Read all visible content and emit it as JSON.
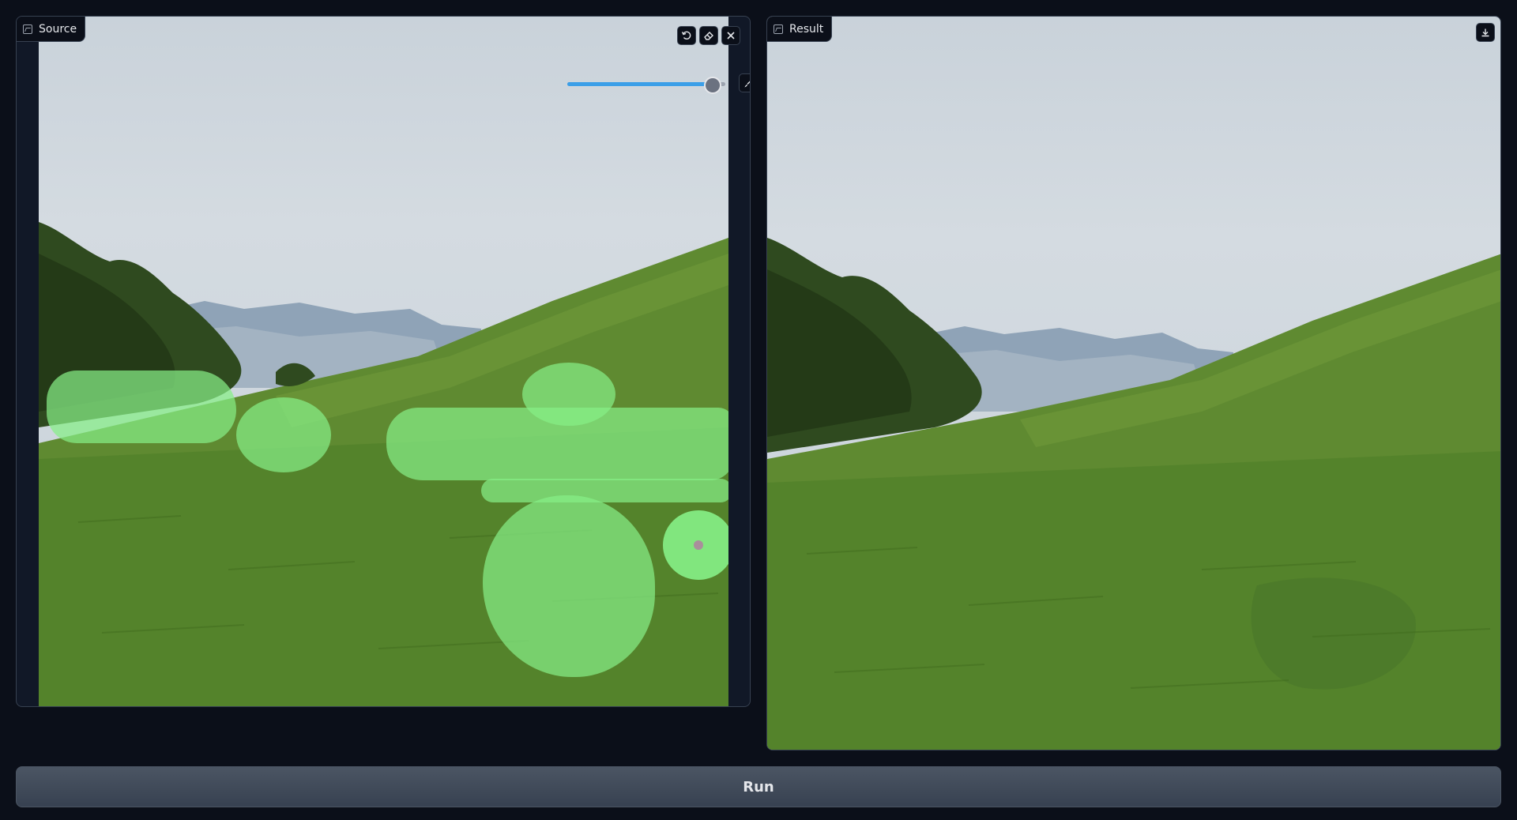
{
  "source_panel": {
    "label": "Source",
    "icons": {
      "label": "image-icon",
      "undo": "undo-icon",
      "erase": "eraser-icon",
      "clear": "close-icon",
      "brush": "brush-icon"
    },
    "brush_size_fraction": 0.92
  },
  "result_panel": {
    "label": "Result",
    "icons": {
      "label": "image-icon",
      "download": "download-icon"
    }
  },
  "run_button": {
    "label": "Run"
  },
  "colors": {
    "background": "#0b0f19",
    "panel": "#111827",
    "border": "#374151",
    "mask": "#86ef86",
    "slider_accent": "#3b9fe8",
    "button": "#4b5563"
  }
}
